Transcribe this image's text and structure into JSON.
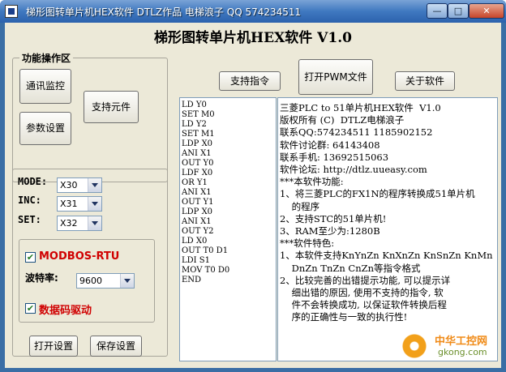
{
  "window": {
    "title": "梯形图转单片机HEX软件   DTLZ作品   电梯浪子  QQ 574234511",
    "minimize_glyph": "—",
    "maximize_glyph": "□",
    "close_glyph": "✕"
  },
  "app_title": "梯形图转单片机HEX软件  V1.0",
  "func_group": {
    "label": "功能操作区",
    "comm_monitor": "通讯监控",
    "support_elements": "支持元件",
    "param_settings": "参数设置"
  },
  "top_buttons": {
    "support_instructions": "支持指令",
    "open_pwm": "打开PWM文件",
    "about": "关于软件"
  },
  "config": {
    "mode_label": "MODE:",
    "mode_value": "X30",
    "inc_label": "INC:",
    "inc_value": "X31",
    "set_label": "SET:",
    "set_value": "X32",
    "modbus_label": "MODBOS-RTU",
    "modbus_checked": true,
    "baud_label": "波特率:",
    "baud_value": "9600",
    "digit_driver_label": "数据码驱动",
    "digit_driver_checked": true,
    "check_glyph": "✔"
  },
  "bottom_buttons": {
    "open_settings": "打开设置",
    "save_settings": "保存设置"
  },
  "ladder_code": [
    "LD Y0",
    "SET M0",
    "LD Y2",
    "SET M1",
    "LDP X0",
    "ANI X1",
    "OUT Y0",
    "LDF X0",
    "OR Y1",
    "ANI X1",
    "OUT Y1",
    "LDP X0",
    "ANI X1",
    "OUT Y2",
    "LD X0",
    "OUT T0 D1",
    "LDI S1",
    "MOV T0 D0",
    "END"
  ],
  "info_lines": [
    "三菱PLC to 51单片机HEX软件  V1.0",
    "版权所有 (C)  DTLZ电梯浪子",
    "联系QQ:574234511 1185902152",
    "软件讨论群: 64143408",
    "联系手机: 13692515063",
    "软件论坛: http://dtlz.uueasy.com",
    "",
    "***本软件功能:",
    "1、将三菱PLC的FX1N的程序转换成51单片机",
    "    的程序",
    "2、支持STC的51单片机!",
    "3、RAM至少为:1280B",
    "",
    "***软件特色:",
    "1、本软件支持KnYnZn KnXnZn KnSnZn KnMn",
    "    DnZn TnZn CnZn等指令格式",
    "2、比较完善的出错提示功能, 可以提示详",
    "    细出错的原因, 使用不支持的指令, 软",
    "    件不会转换成功, 以保证软件转换后程",
    "    序的正确性与一致的执行性!"
  ],
  "watermark": {
    "text": "中华工控网",
    "url": "gkong.com"
  }
}
